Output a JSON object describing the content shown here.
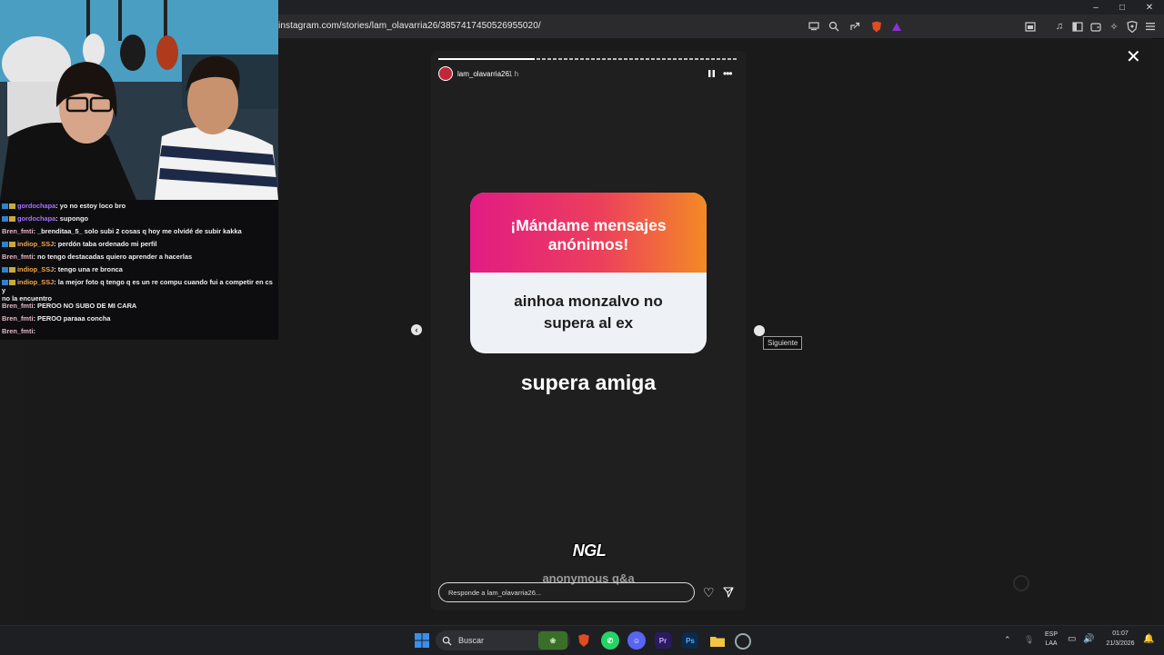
{
  "browser": {
    "url": "instagram.com/stories/lam_olavarria26/3857417450526955020/",
    "window_controls": [
      "–",
      "□",
      "✕"
    ]
  },
  "chat": [
    {
      "user": "gordochapa",
      "message": ": yo no estoy loco bro",
      "color": "purple",
      "badges": 2
    },
    {
      "user": "gordochapa",
      "message": ": supongo",
      "color": "purple",
      "badges": 2
    },
    {
      "user": "Bren_fmti",
      "message": ": _brenditaa_5_ solo subi 2 cosas q hoy me olvidé de subir kakka",
      "color": "pink",
      "badges": 0
    },
    {
      "user": "indiop_SSJ",
      "message": ": perdón taba ordenado mi perfil",
      "color": "orange",
      "badges": 2
    },
    {
      "user": "Bren_fmti",
      "message": ": no tengo destacadas quiero aprender a hacerlas",
      "color": "pink",
      "badges": 0
    },
    {
      "user": "indiop_SSJ",
      "message": ": tengo una re bronca",
      "color": "orange",
      "badges": 2
    },
    {
      "user": "indiop_SSJ",
      "message": ": la mejor foto q tengo q es un re compu cuando fui a competir en cs y",
      "continuation": "no la encuentro",
      "color": "orange",
      "badges": 2
    },
    {
      "user": "Bren_fmti",
      "message": ": PEROO NO SUBO DE MI CARA",
      "color": "pink",
      "badges": 0
    },
    {
      "user": "Bren_fmti",
      "message": ": PEROO paraaa concha",
      "color": "pink",
      "badges": 0
    },
    {
      "user": "Bren_fmti",
      "message": ":",
      "color": "pink",
      "badges": 0
    }
  ],
  "story": {
    "username": "lam_olavarria26",
    "time": "1 h",
    "progress": 0.32,
    "question_title": "¡Mándame mensajes anónimos!",
    "question_answer": "ainhoa monzalvo no supera al ex",
    "reply_text": "supera amiga",
    "ngl_logo": "NGL",
    "ngl_caption": "anonymous q&a",
    "reply_placeholder": "Responde a lam_olavarria26...",
    "next_tooltip": "Siguiente",
    "close_icon": "✕"
  },
  "taskbar": {
    "search_label": "Buscar",
    "language": "ESP",
    "layout": "LAA",
    "time": "01:07",
    "date": "21/3/2026",
    "apps": [
      "windows-logo",
      "brave",
      "whatsapp",
      "discord",
      "premiere",
      "photoshop",
      "file-explorer",
      "steam"
    ],
    "colors": {
      "accent": "#3b8eea",
      "brave": "#e24a1f",
      "whatsapp": "#25d366",
      "discord": "#5865f2",
      "premiere": "#2a1a5e",
      "photoshop": "#0c2a4a"
    }
  }
}
